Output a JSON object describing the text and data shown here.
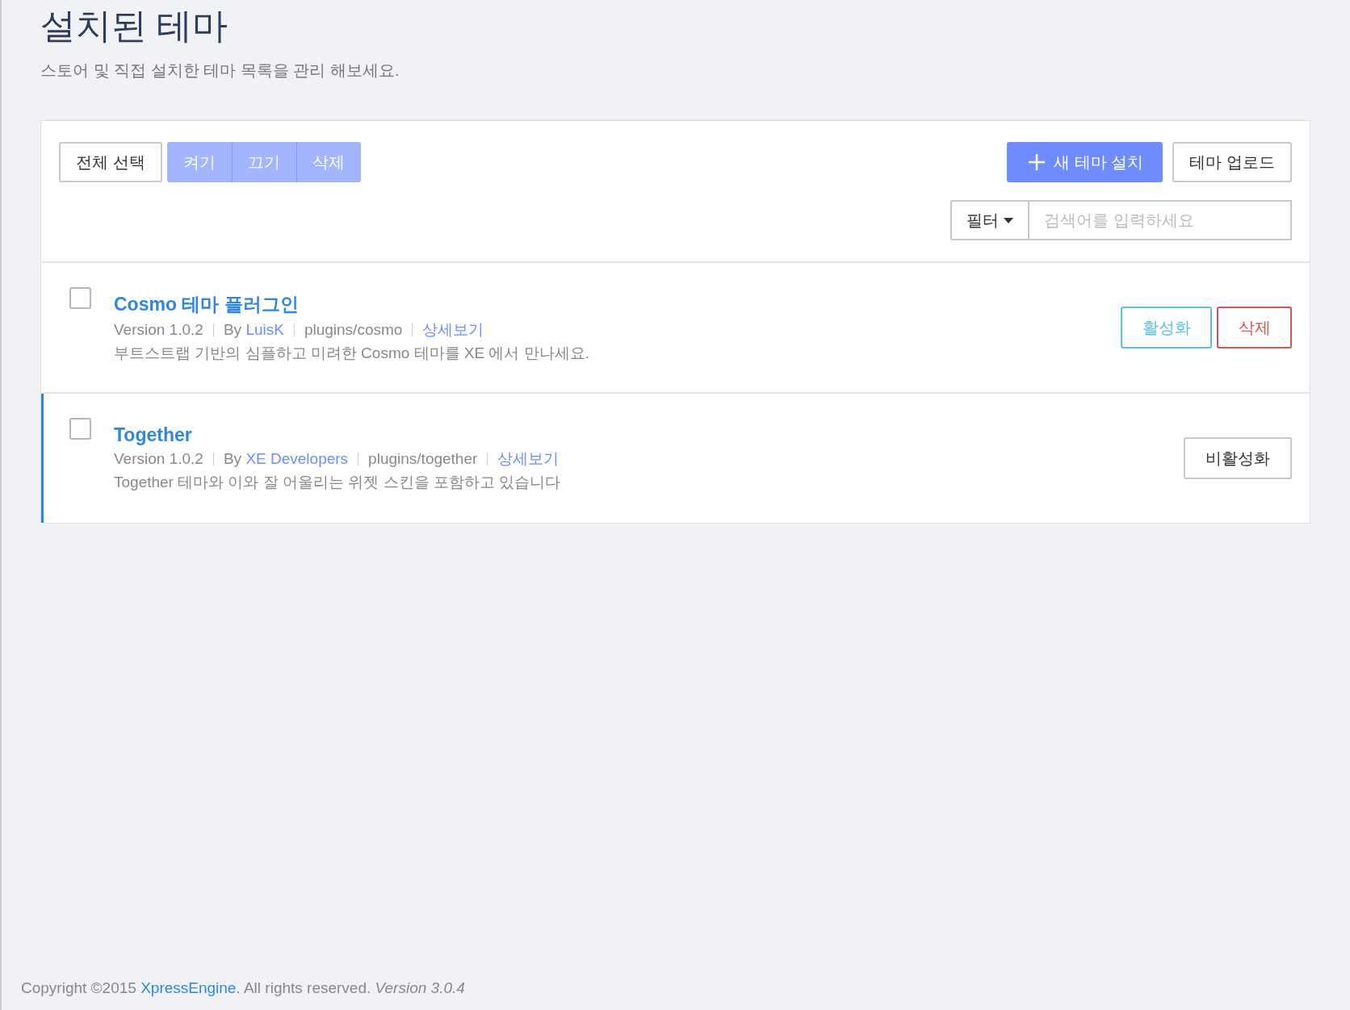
{
  "header": {
    "title": "설치된 테마",
    "subtitle": "스토어 및 직접 설치한 테마 목록을 관리 해보세요."
  },
  "toolbar": {
    "select_all": "전체 선택",
    "bulk_actions": [
      {
        "label": "켜기",
        "disabled": true
      },
      {
        "label": "끄기",
        "disabled": true
      },
      {
        "label": "삭제",
        "disabled": true
      }
    ],
    "install_button": "새 테마 설치",
    "upload_button": "테마 업로드",
    "filter": "필터",
    "search": {
      "placeholder": "검색어를 입력하세요"
    }
  },
  "themes": [
    {
      "name": "Cosmo 테마 플러그인",
      "checked": false,
      "active": false,
      "version": "Version 1.0.2",
      "by": "By",
      "author": "LuisK",
      "path": "plugins/cosmo",
      "details": "상세보기",
      "description": "부트스트랩 기반의 심플하고 미려한 Cosmo 테마를 XE 에서 만나세요.",
      "actions": [
        {
          "kind": "activate",
          "label": "활성화"
        },
        {
          "kind": "delete",
          "label": "삭제"
        }
      ]
    },
    {
      "name": "Together",
      "checked": false,
      "active": true,
      "version": "Version 1.0.2",
      "by": "By",
      "author": "XE Developers",
      "path": "plugins/together",
      "details": "상세보기",
      "description": "Together 테마와 이와 잘 어울리는 위젯 스킨을 포함하고 있습니다",
      "actions": [
        {
          "kind": "deactivate",
          "label": "비활성화"
        }
      ]
    }
  ],
  "footer": {
    "prefix": "Copyright ©2015 ",
    "link": "XpressEngine",
    "suffix": ". All rights reserved. *Version 3.0.4*"
  }
}
